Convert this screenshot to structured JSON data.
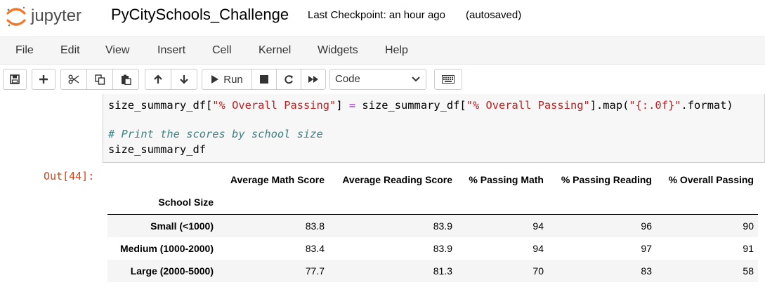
{
  "header": {
    "logo_text": "jupyter",
    "notebook_title": "PyCitySchools_Challenge",
    "checkpoint": "Last Checkpoint: an hour ago",
    "autosave": "(autosaved)",
    "logo_colors": {
      "arc": "#f37726",
      "text": "#4e4e4e"
    }
  },
  "menubar": {
    "items": [
      "File",
      "Edit",
      "View",
      "Insert",
      "Cell",
      "Kernel",
      "Widgets",
      "Help"
    ]
  },
  "toolbar": {
    "run_label": "Run",
    "cell_type": "Code",
    "icons": [
      "save-icon",
      "plus-icon",
      "scissors-icon",
      "copy-icon",
      "paste-icon",
      "arrow-up-icon",
      "arrow-down-icon",
      "play-icon",
      "stop-icon",
      "restart-icon",
      "fast-forward-icon",
      "chevron-down-icon",
      "keyboard-icon"
    ]
  },
  "cell": {
    "code": {
      "line1": {
        "p1": "size_summary_df[",
        "s1": "\"% Overall Passing\"",
        "p2": "] ",
        "op": "=",
        "p3": " size_summary_df[",
        "s2": "\"% Overall Passing\"",
        "p4": "].map(",
        "s3": "\"{:.0f}\"",
        "p5": ".format)"
      },
      "comment": "# Print the scores by school size",
      "line3": "size_summary_df"
    },
    "output_prompt": "Out[44]:"
  },
  "table": {
    "columns": [
      "Average Math Score",
      "Average Reading Score",
      "% Passing Math",
      "% Passing Reading",
      "% Overall Passing"
    ],
    "index_name": "School Size",
    "rows": [
      {
        "label": "Small (<1000)",
        "values": [
          "83.8",
          "83.9",
          "94",
          "96",
          "90"
        ]
      },
      {
        "label": "Medium (1000-2000)",
        "values": [
          "83.4",
          "83.9",
          "94",
          "97",
          "91"
        ]
      },
      {
        "label": "Large (2000-5000)",
        "values": [
          "77.7",
          "81.3",
          "70",
          "83",
          "58"
        ]
      }
    ]
  },
  "colors": {
    "prompt_out": "#d84315",
    "string": "#ba2121",
    "operator": "#aa22ff",
    "comment": "#408080",
    "menubar_bg": "#f5f5f5",
    "code_bg": "#f7f7f7"
  }
}
